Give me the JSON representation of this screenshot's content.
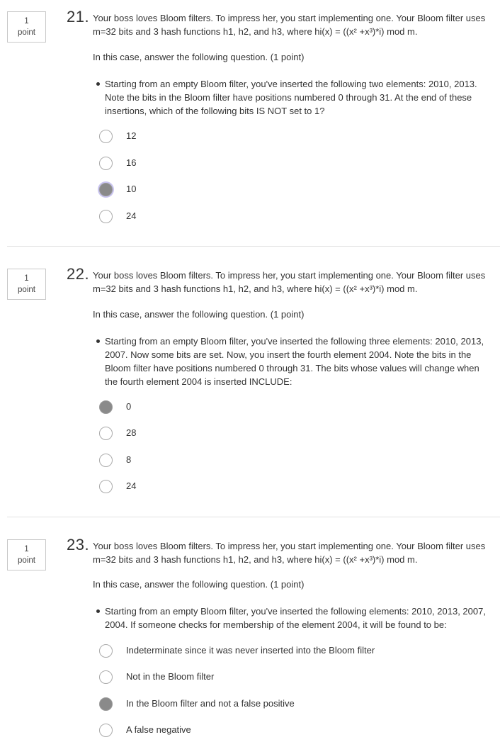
{
  "questions": [
    {
      "points": "1",
      "points_unit": "point",
      "number": "21.",
      "text": "Your boss loves Bloom filters. To impress her, you start implementing one. Your Bloom filter uses m=32 bits and 3 hash functions h1, h2, and h3, where hi(x) = ((x² +x³)*i) mod m.",
      "instruction": "In this case, answer the following question. (1 point)",
      "bullet": "Starting from an empty Bloom filter, you've inserted the following two elements: 2010, 2013. Note the bits in the Bloom filter have positions numbered 0 through 31. At the end of these insertions, which of the following bits IS NOT set to 1?",
      "options": [
        "12",
        "16",
        "10",
        "24"
      ],
      "selected": 2
    },
    {
      "points": "1",
      "points_unit": "point",
      "number": "22.",
      "text": "Your boss loves Bloom filters. To impress her, you start implementing one. Your Bloom filter uses m=32 bits and 3 hash functions h1, h2, and h3, where hi(x) = ((x² +x³)*i) mod m.",
      "instruction": "In this case, answer the following question. (1 point)",
      "bullet": "Starting from an empty Bloom filter, you've inserted the following three elements: 2010, 2013, 2007. Now some bits are set. Now, you insert the fourth element 2004. Note the bits in the Bloom filter have positions numbered 0 through 31. The bits whose values will change when the fourth element 2004 is inserted INCLUDE:",
      "options": [
        "0",
        "28",
        "8",
        "24"
      ],
      "selected": 0
    },
    {
      "points": "1",
      "points_unit": "point",
      "number": "23.",
      "text": "Your boss loves Bloom filters. To impress her, you start implementing one. Your Bloom filter uses m=32 bits and 3 hash functions h1, h2, and h3, where hi(x) = ((x² +x³)*i) mod m.",
      "instruction": "In this case, answer the following question. (1 point)",
      "bullet": "Starting from an empty Bloom filter, you've inserted the following elements: 2010, 2013, 2007, 2004. If someone checks for membership of the element 2004, it will be found to be:",
      "options": [
        "Indeterminate since it was never inserted into the Bloom filter",
        "Not in the Bloom filter",
        "In the Bloom filter and not a false positive",
        "A false negative"
      ],
      "selected": 2
    }
  ]
}
